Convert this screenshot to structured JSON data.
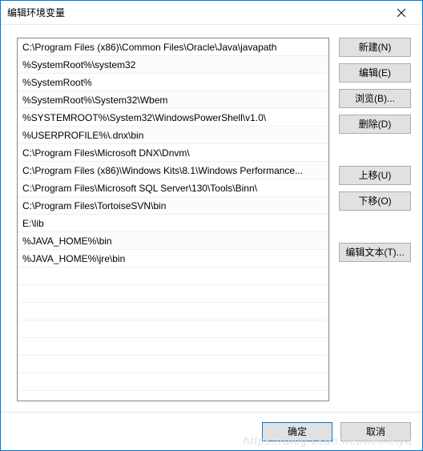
{
  "title": "编辑环境变量",
  "paths": [
    "C:\\Program Files (x86)\\Common Files\\Oracle\\Java\\javapath",
    "%SystemRoot%\\system32",
    "%SystemRoot%",
    "%SystemRoot%\\System32\\Wbem",
    "%SYSTEMROOT%\\System32\\WindowsPowerShell\\v1.0\\",
    "%USERPROFILE%\\.dnx\\bin",
    "C:\\Program Files\\Microsoft DNX\\Dnvm\\",
    "C:\\Program Files (x86)\\Windows Kits\\8.1\\Windows Performance...",
    "C:\\Program Files\\Microsoft SQL Server\\130\\Tools\\Binn\\",
    "C:\\Program Files\\TortoiseSVN\\bin",
    "E:\\lib",
    "%JAVA_HOME%\\bin",
    "%JAVA_HOME%\\jre\\bin"
  ],
  "buttons": {
    "new": "新建(N)",
    "edit": "编辑(E)",
    "browse": "浏览(B)...",
    "delete": "删除(D)",
    "moveup": "上移(U)",
    "movedown": "下移(O)",
    "edittext": "编辑文本(T)..."
  },
  "footer": {
    "ok": "确定",
    "cancel": "取消"
  },
  "watermark": "https://blog.csdn.net/heiheiya"
}
